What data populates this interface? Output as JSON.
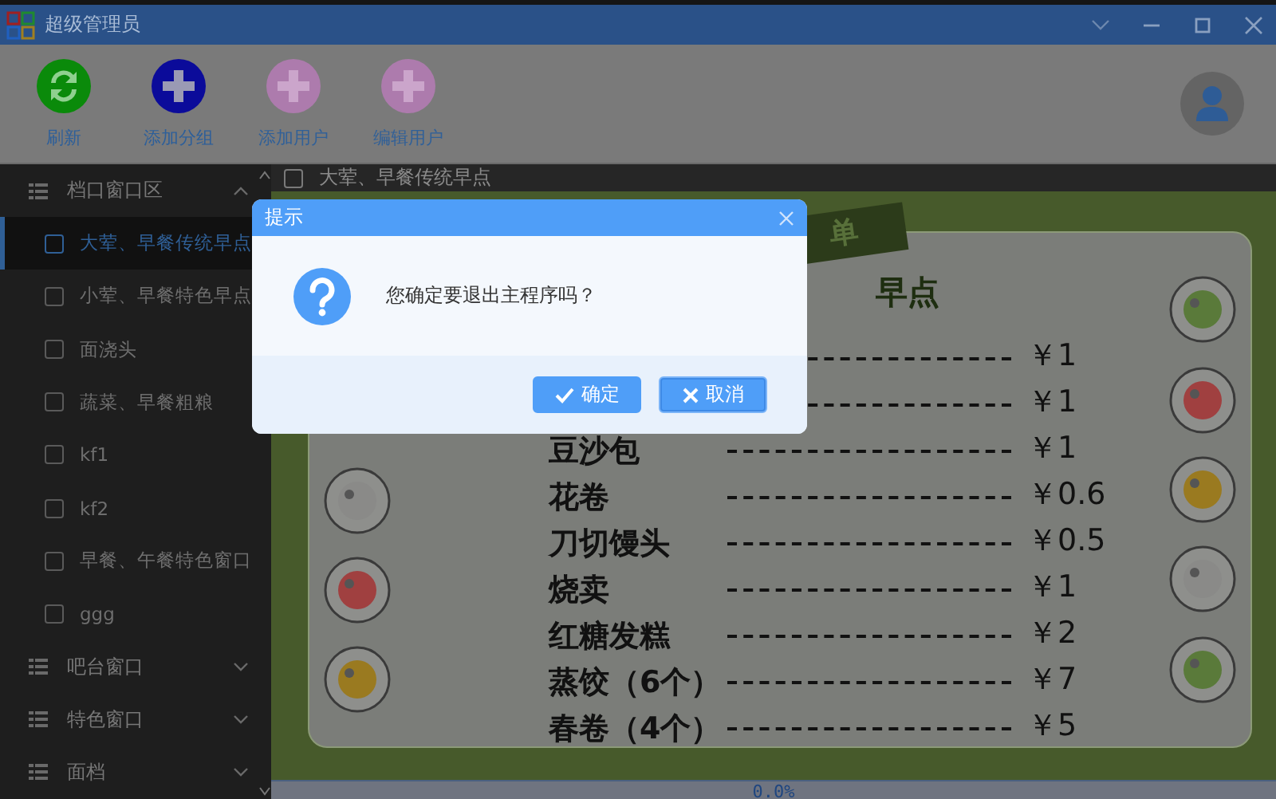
{
  "window": {
    "title": "超级管理员"
  },
  "toolbar": [
    {
      "label": "刷新",
      "kind": "refresh",
      "disabled": false
    },
    {
      "label": "添加分组",
      "kind": "add",
      "disabled": false
    },
    {
      "label": "添加用户",
      "kind": "add",
      "disabled": true
    },
    {
      "label": "编辑用户",
      "kind": "add",
      "disabled": true
    }
  ],
  "sidebar": {
    "groups": [
      {
        "label": "档口窗口区",
        "expanded": true,
        "children": [
          {
            "label": "大荤、早餐传统早点",
            "checked": false,
            "selected": true
          },
          {
            "label": "小荤、早餐特色早点",
            "checked": false,
            "selected": false
          },
          {
            "label": "面浇头",
            "checked": false,
            "selected": false
          },
          {
            "label": "蔬菜、早餐粗粮",
            "checked": false,
            "selected": false
          },
          {
            "label": "kf1",
            "checked": false,
            "selected": false
          },
          {
            "label": "kf2",
            "checked": false,
            "selected": false
          },
          {
            "label": "早餐、午餐特色窗口",
            "checked": false,
            "selected": false
          },
          {
            "label": "ggg",
            "checked": false,
            "selected": false
          }
        ]
      },
      {
        "label": "吧台窗口",
        "expanded": false
      },
      {
        "label": "特色窗口",
        "expanded": false
      },
      {
        "label": "面档",
        "expanded": false
      }
    ]
  },
  "content_header": {
    "label": "大荤、早餐传统早点",
    "checked": false
  },
  "menu_image": {
    "ribbon": "单",
    "title": "早点",
    "rows": [
      {
        "price": "￥1"
      },
      {
        "price": "￥1"
      },
      {
        "name": "豆沙包",
        "price": "￥1"
      },
      {
        "name": "花卷",
        "price": "￥0.6"
      },
      {
        "name": "刀切馒头",
        "price": "￥0.5"
      },
      {
        "name": "烧卖",
        "price": "￥1"
      },
      {
        "name": "红糖发糕",
        "price": "￥2"
      },
      {
        "name": "蒸饺（6个）",
        "price": "￥7"
      },
      {
        "name": "春卷（4个）",
        "price": "￥5"
      }
    ]
  },
  "status_bar": {
    "progress": "0.0%"
  },
  "dialog": {
    "title": "提示",
    "message": "您确定要退出主程序吗？",
    "buttons": [
      {
        "label": "确定",
        "kind": "ok"
      },
      {
        "label": "取消",
        "kind": "cancel"
      }
    ]
  }
}
